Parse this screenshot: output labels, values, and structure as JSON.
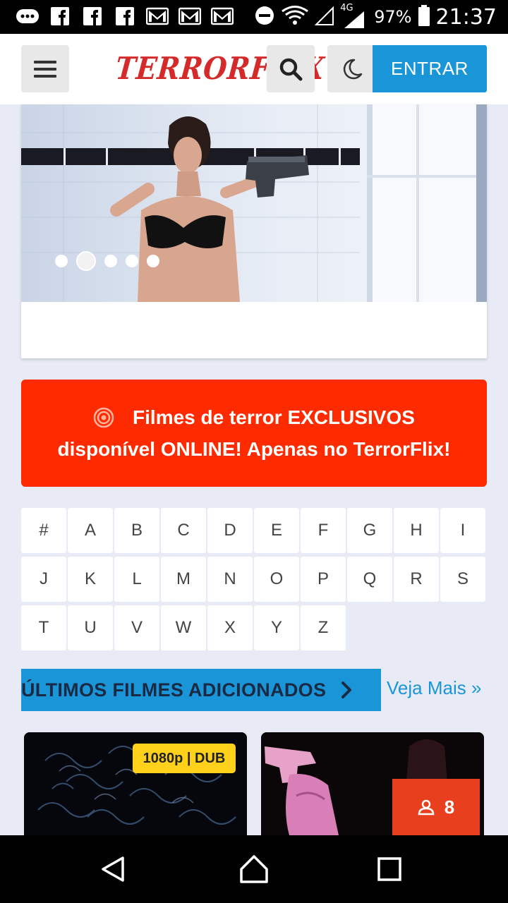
{
  "status_bar": {
    "battery": "97%",
    "time": "21:37",
    "network": "4G",
    "notification_icons": [
      "chat-icon",
      "facebook-icon",
      "facebook-icon",
      "facebook-icon",
      "gmail-icon",
      "gmail-icon",
      "gmail-icon",
      "dnd-icon",
      "wifi-icon"
    ]
  },
  "header": {
    "logo": "TERRORFLIX",
    "login_label": "ENTRAR",
    "accent": "#1a96d8",
    "logo_color": "#d42a2a"
  },
  "hero": {
    "slide_count": 5,
    "active_slide": 2
  },
  "promo": {
    "line1": "Filmes de terror EXCLUSIVOS",
    "line2": "disponível ONLINE! Apenas no TerrorFlix!",
    "color": "#ff2b00"
  },
  "alphabet": [
    "#",
    "A",
    "B",
    "C",
    "D",
    "E",
    "F",
    "G",
    "H",
    "I",
    "J",
    "K",
    "L",
    "M",
    "N",
    "O",
    "P",
    "Q",
    "R",
    "S",
    "T",
    "U",
    "V",
    "W",
    "X",
    "Y",
    "Z"
  ],
  "section": {
    "title": "ÚLTIMOS FILMES ADICIONADOS",
    "see_more": "Veja Mais »"
  },
  "cards": [
    {
      "badge": "1080p | DUB"
    },
    {
      "views": "8"
    }
  ]
}
